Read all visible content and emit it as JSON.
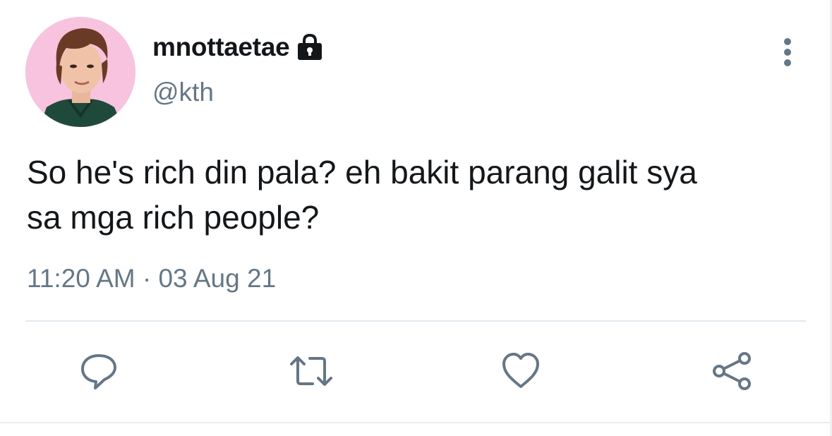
{
  "user": {
    "display_name": "mnottaetae",
    "handle": "@kth",
    "protected_icon": "lock-icon",
    "avatar_icon": "avatar-photo"
  },
  "tweet": {
    "text": "So he's rich din pala? eh bakit parang galit sya\nsa mga rich people?",
    "time": "11:20 AM",
    "separator": "·",
    "date": "03 Aug 21"
  },
  "actions": [
    {
      "name": "reply",
      "icon": "reply-icon"
    },
    {
      "name": "retweet",
      "icon": "retweet-icon"
    },
    {
      "name": "like",
      "icon": "heart-icon"
    },
    {
      "name": "share",
      "icon": "share-icon"
    }
  ],
  "colors": {
    "text_primary": "#14171a",
    "text_secondary": "#657786",
    "icon": "#657786",
    "divider": "#e1e8ed",
    "avatar_bg": "#f7c3df"
  }
}
